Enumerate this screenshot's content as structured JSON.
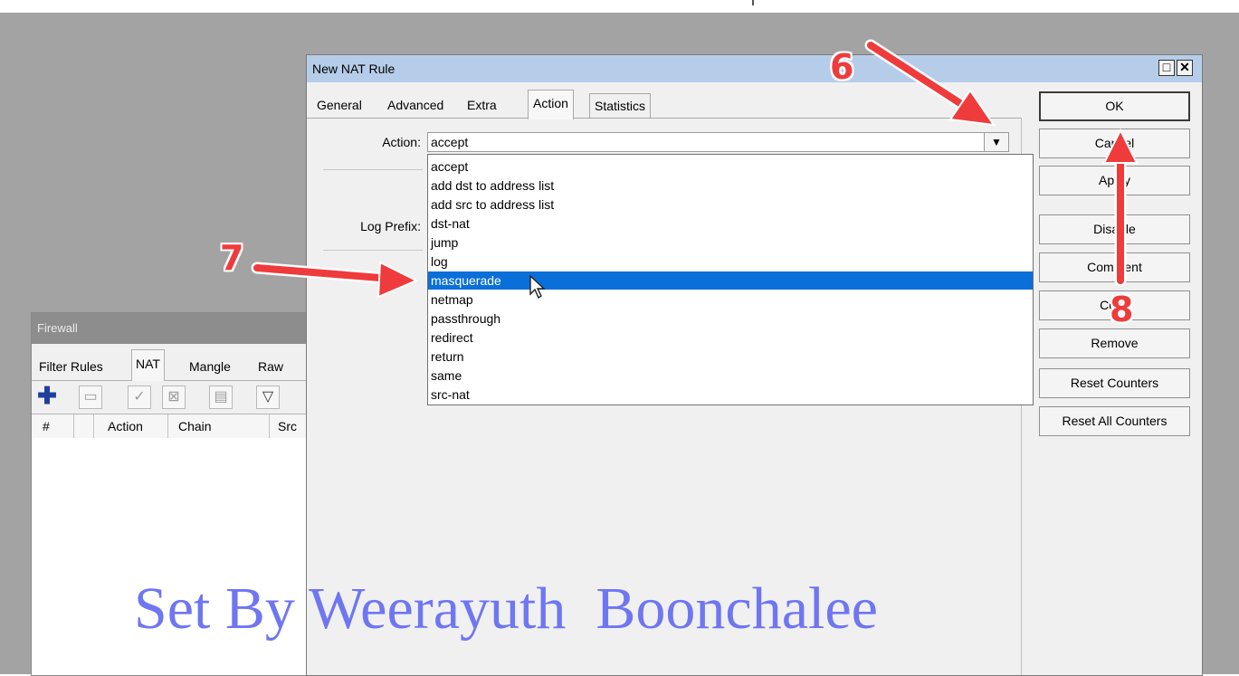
{
  "firewall": {
    "title": "Firewall",
    "tabs": [
      "Filter Rules",
      "NAT",
      "Mangle",
      "Raw"
    ],
    "active_tab": "NAT",
    "columns": [
      "#",
      "Action",
      "Chain",
      "Src"
    ]
  },
  "nat_rule": {
    "title": "New NAT Rule",
    "tabs": [
      "General",
      "Advanced",
      "Extra",
      "Action",
      "Statistics"
    ],
    "active_tab": "Action",
    "action_label": "Action:",
    "action_value": "accept",
    "log_prefix_label": "Log Prefix:",
    "options": [
      "accept",
      "add dst to address list",
      "add src to address list",
      "dst-nat",
      "jump",
      "log",
      "masquerade",
      "netmap",
      "passthrough",
      "redirect",
      "return",
      "same",
      "src-nat"
    ],
    "highlighted_option": "masquerade",
    "buttons": {
      "ok": "OK",
      "cancel": "Cancel",
      "apply": "Apply",
      "disable": "Disable",
      "comment": "Comment",
      "copy": "Copy",
      "remove": "Remove",
      "reset_counters": "Reset Counters",
      "reset_all_counters": "Reset All Counters"
    }
  },
  "annotations": {
    "step6": "6",
    "step7": "7",
    "step8": "8",
    "arrow_color": "#ef3b3b"
  },
  "watermark": "Set By Weerayuth  Boonchalee",
  "colors": {
    "selection": "#0a6fd8",
    "dialog_title_bar": "#b6cde9",
    "watermark": "#6f76f2"
  }
}
